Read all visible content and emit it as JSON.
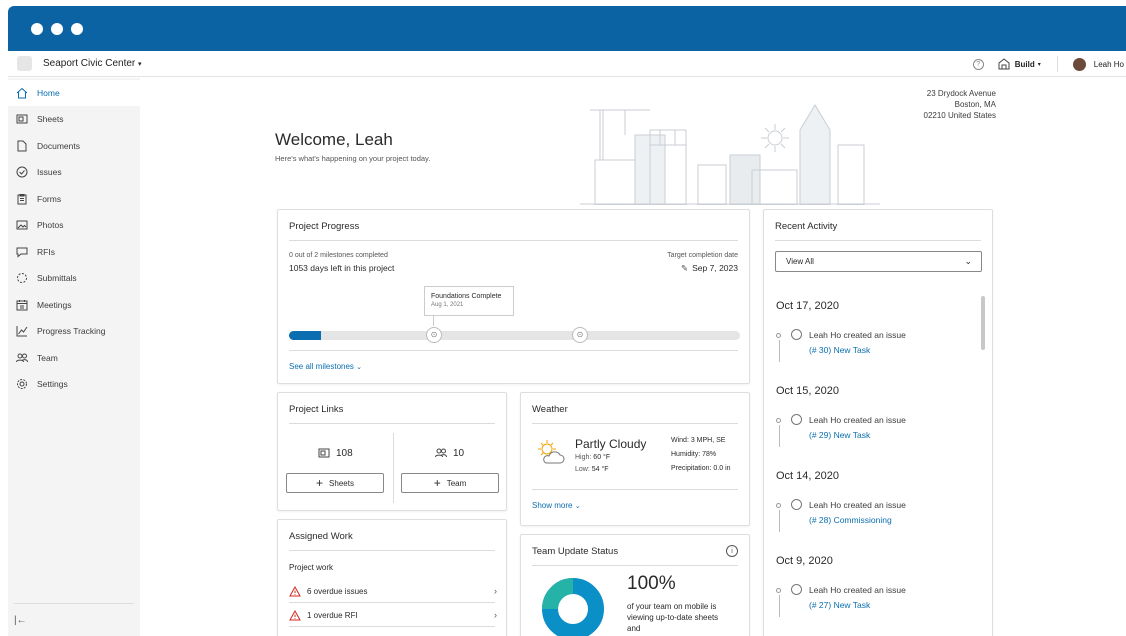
{
  "header": {
    "project_name": "Seaport Civic Center",
    "build_label": "Build",
    "help_icon": "question-circle-icon",
    "user_name": "Leah Ho"
  },
  "sidebar": {
    "items": [
      {
        "label": "Home",
        "icon": "home-icon",
        "active": true
      },
      {
        "label": "Sheets",
        "icon": "sheets-icon"
      },
      {
        "label": "Documents",
        "icon": "document-icon"
      },
      {
        "label": "Issues",
        "icon": "issue-check-icon"
      },
      {
        "label": "Forms",
        "icon": "clipboard-icon"
      },
      {
        "label": "Photos",
        "icon": "photo-icon"
      },
      {
        "label": "RFIs",
        "icon": "chat-bubble-icon"
      },
      {
        "label": "Submittals",
        "icon": "submittal-icon"
      },
      {
        "label": "Meetings",
        "icon": "calendar-icon"
      },
      {
        "label": "Progress Tracking",
        "icon": "line-chart-icon"
      },
      {
        "label": "Team",
        "icon": "team-icon"
      },
      {
        "label": "Settings",
        "icon": "gear-icon"
      }
    ],
    "collapse_glyph": "|←"
  },
  "address": {
    "line1": "23 Drydock Avenue",
    "line2": "Boston, MA",
    "line3": "02210 United States"
  },
  "welcome": {
    "title": "Welcome, Leah",
    "subtitle": "Here's what's happening on your project today."
  },
  "progress": {
    "title": "Project Progress",
    "milestones_text": "0 out of 2 milestones completed",
    "days_left": "1053 days left in this project",
    "target_label": "Target completion date",
    "target_date": "Sep 7, 2023",
    "tooltip_title": "Foundations Complete",
    "tooltip_date": "Aug 1, 2021",
    "progress_fraction": 0.07,
    "see_all": "See all milestones"
  },
  "links": {
    "title": "Project Links",
    "sheets_count": "108",
    "team_count": "10",
    "sheets_button": "Sheets",
    "team_button": "Team"
  },
  "weather": {
    "title": "Weather",
    "condition": "Partly Cloudy",
    "high_label": "High:",
    "high_value": "60 °F",
    "low_label": "Low:",
    "low_value": "54 °F",
    "wind": "Wind: 3 MPH, SE",
    "humidity": "Humidity: 78%",
    "precip": "Precipitation: 0.0 in",
    "show_more": "Show more"
  },
  "assigned": {
    "title": "Assigned Work",
    "section": "Project work",
    "rows": [
      "6 overdue issues",
      "1 overdue RFI"
    ]
  },
  "team_status": {
    "title": "Team Update Status",
    "percent": "100%",
    "description": "of your team on mobile is viewing up-to-date sheets and"
  },
  "activity": {
    "title": "Recent Activity",
    "filter": "View All",
    "groups": [
      {
        "date": "Oct 17, 2020",
        "text": "Leah Ho created an issue",
        "link": "(# 30) New Task"
      },
      {
        "date": "Oct 15, 2020",
        "text": "Leah Ho created an issue",
        "link": "(# 29) New Task"
      },
      {
        "date": "Oct 14, 2020",
        "text": "Leah Ho created an issue",
        "link": "(# 28) Commissioning"
      },
      {
        "date": "Oct 9, 2020",
        "text": "Leah Ho created an issue",
        "link": "(# 27) New Task"
      }
    ]
  },
  "colors": {
    "titlebar": "#0b63a4",
    "accent": "#0b6eb0",
    "progress_fill": "#0b6eb0",
    "warning": "#d0271d",
    "donut": "#0b8fc7"
  }
}
